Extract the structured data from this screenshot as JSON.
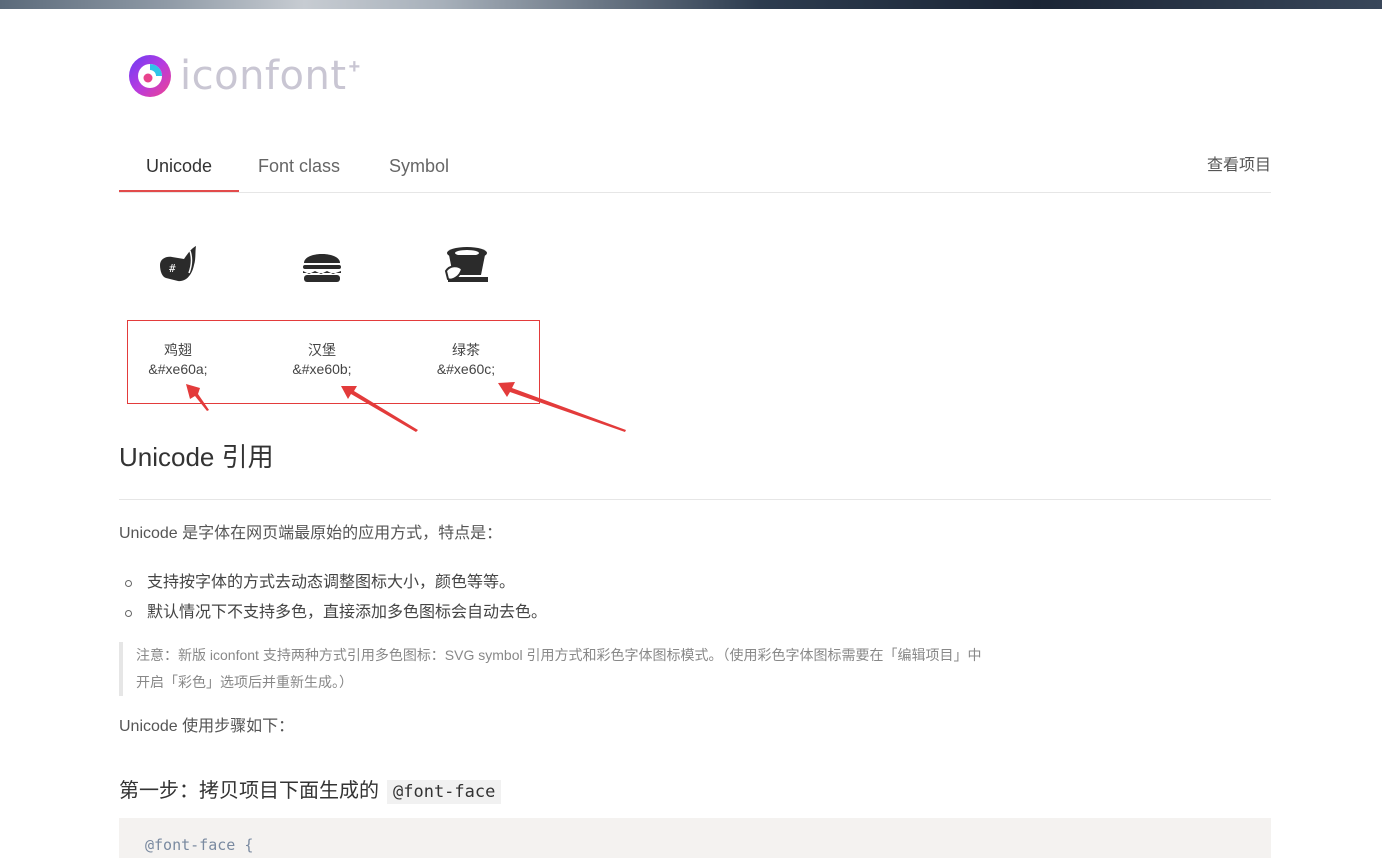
{
  "colors": {
    "accent": "#e24b4b",
    "annotation_red": "#e33b3b",
    "logo_text": "#c9c6d3"
  },
  "logo": {
    "text": "iconfont",
    "sup": "+"
  },
  "tabs": [
    {
      "label": "Unicode",
      "active": true
    },
    {
      "label": "Font class",
      "active": false
    },
    {
      "label": "Symbol",
      "active": false
    }
  ],
  "project_link": "查看项目",
  "icons": [
    {
      "name": "鸡翅",
      "code": "&#xe60a;",
      "icon": "chicken-wing-icon"
    },
    {
      "name": "汉堡",
      "code": "&#xe60b;",
      "icon": "hamburger-icon"
    },
    {
      "name": "绿茶",
      "code": "&#xe60c;",
      "icon": "green-tea-icon"
    }
  ],
  "content": {
    "heading": "Unicode 引用",
    "intro": "Unicode 是字体在网页端最原始的应用方式，特点是：",
    "bullets": [
      "支持按字体的方式去动态调整图标大小，颜色等等。",
      "默认情况下不支持多色，直接添加多色图标会自动去色。"
    ],
    "note_line1": "注意：新版 iconfont 支持两种方式引用多色图标：SVG symbol 引用方式和彩色字体图标模式。（使用彩色字体图标需要在「编辑项目」中",
    "note_line2": "开启「彩色」选项后并重新生成。）",
    "usage": "Unicode 使用步骤如下：",
    "step1": "第一步：拷贝项目下面生成的",
    "step1_code": "@font-face",
    "code_first_line": "@font-face {"
  }
}
